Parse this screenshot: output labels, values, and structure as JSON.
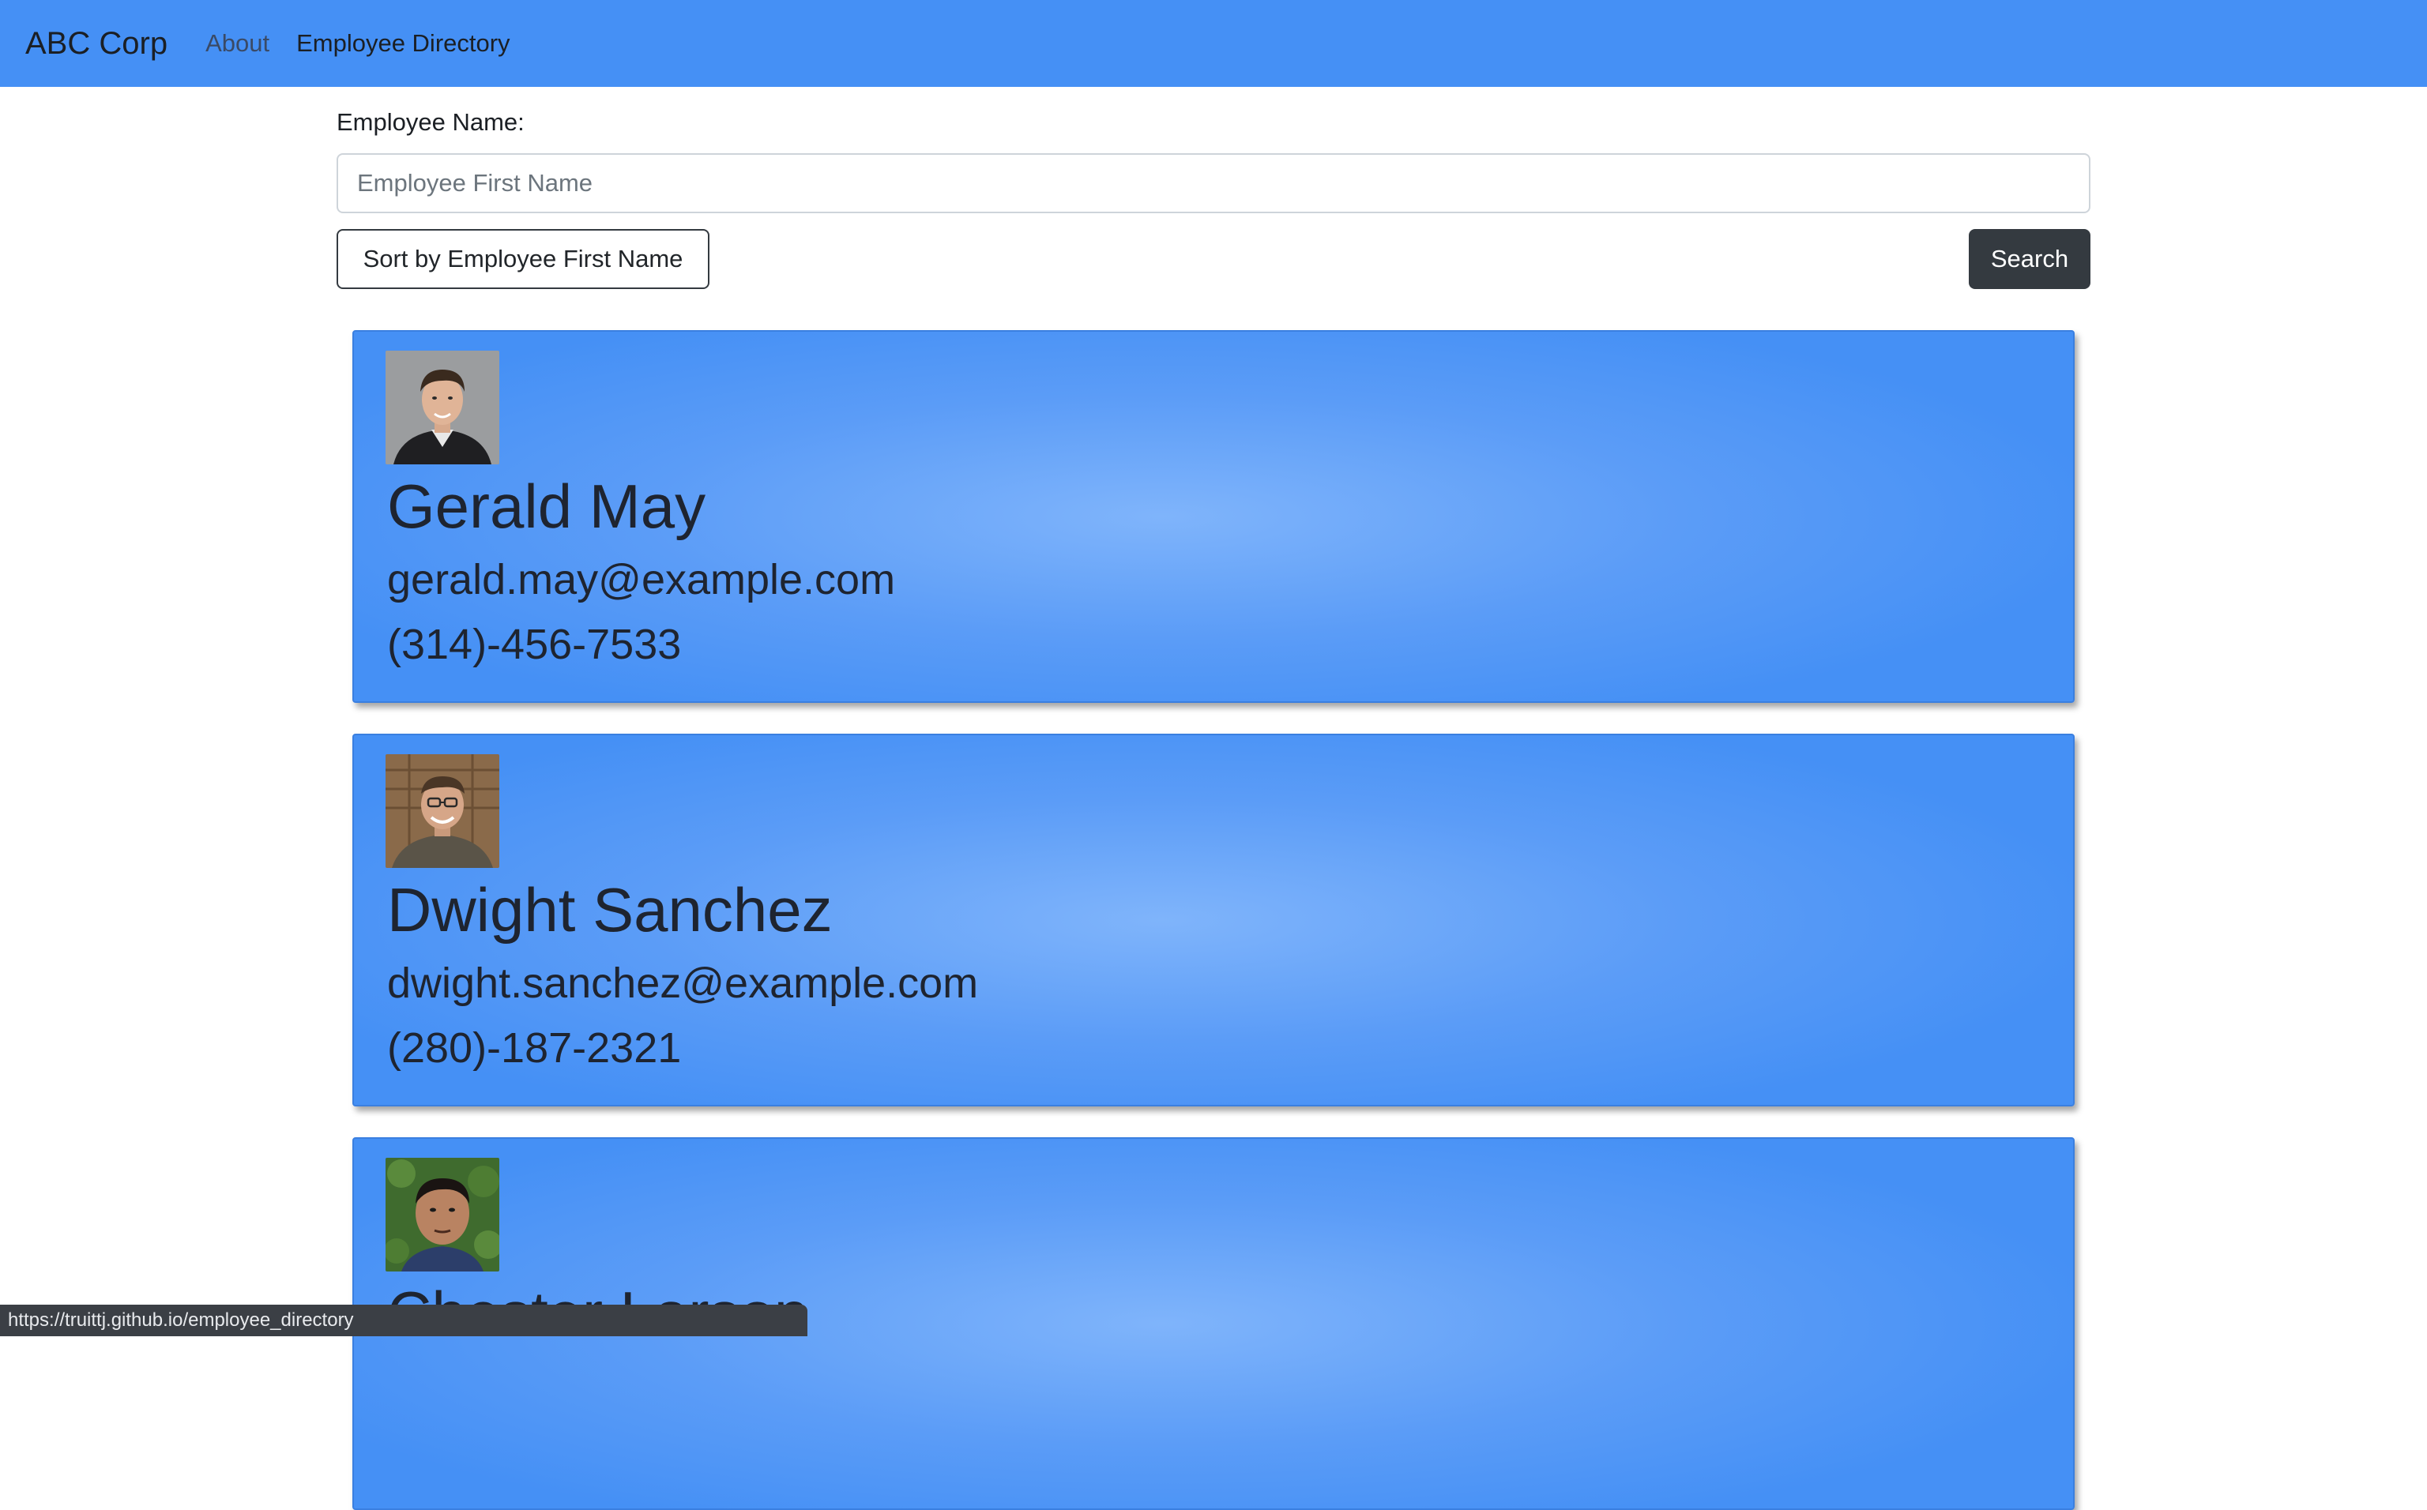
{
  "navbar": {
    "brand": "ABC Corp",
    "links": [
      "About",
      "Employee Directory"
    ],
    "background_color": "#4590f5"
  },
  "search_form": {
    "label": "Employee Name:",
    "input_placeholder": "Employee First Name",
    "input_value": "",
    "sort_button_label": "Sort by Employee First Name",
    "search_button_label": "Search"
  },
  "employees": [
    {
      "name": "Gerald May",
      "email": "gerald.may@example.com",
      "phone": "(314)-456-7533",
      "avatar_icon": "employee-photo"
    },
    {
      "name": "Dwight Sanchez",
      "email": "dwight.sanchez@example.com",
      "phone": "(280)-187-2321",
      "avatar_icon": "employee-photo"
    },
    {
      "name": "Chester Larson",
      "email": "",
      "phone": "",
      "avatar_icon": "employee-photo"
    }
  ],
  "status_bar": {
    "url": "https://truittj.github.io/employee_directory"
  },
  "colors": {
    "card_accent": "#4590f5",
    "dark_button": "#343a40"
  }
}
